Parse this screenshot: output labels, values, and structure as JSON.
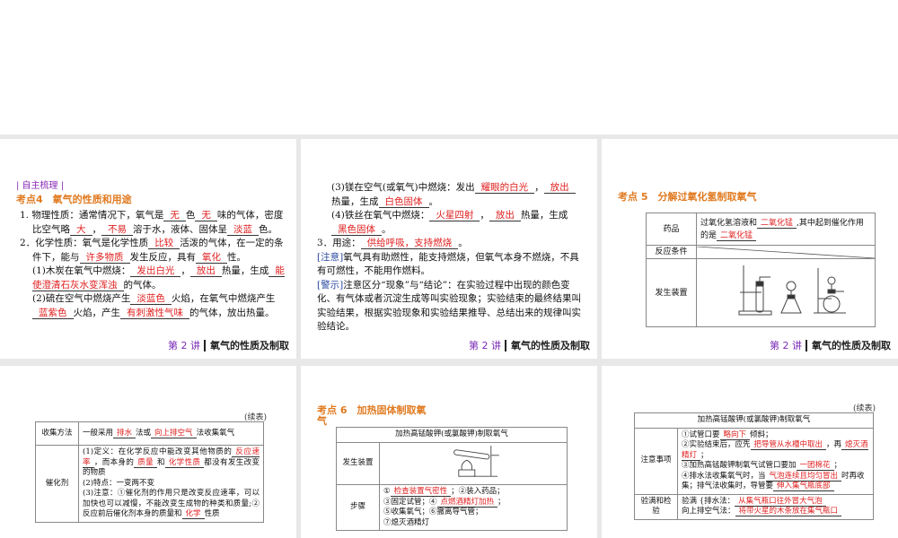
{
  "footer": {
    "num": "第 2 讲",
    "title": "氧气的性质及制取"
  },
  "s1": {
    "tag": "| 自主梳理 |",
    "heading": "考点4　氧气的性质和用途",
    "blocks": [
      [
        "1.  物理性质：通常情况下，氧气是",
        {
          "b": "无"
        },
        "色",
        {
          "b": "无"
        },
        "味的气体，密度比空气略",
        {
          "b": "大"
        },
        "，",
        {
          "b": "不易"
        },
        "溶于水，液体、固体呈",
        {
          "b": "淡蓝"
        },
        "色。"
      ],
      [
        "2．化学性质：氧气是化学性质",
        {
          "b": "比较"
        },
        "活泼的气体，在一定的条件下，能与",
        {
          "b": "许多物质"
        },
        "发生反应，具有",
        {
          "b": "氧化"
        },
        "性。"
      ],
      [
        "(1)木炭在氧气中燃烧：",
        {
          "b": "发出白光"
        },
        "，",
        {
          "b": "放出"
        },
        "热量，生成",
        {
          "b": "能使澄清石灰水变浑浊"
        },
        "的气体。"
      ],
      [
        "(2)硫在空气中燃烧产生",
        {
          "b": "淡蓝色"
        },
        "火焰，在氧气中燃烧产生",
        {
          "b": "蓝紫色"
        },
        "火焰，产生",
        {
          "b": "有刺激性气味"
        },
        "的气体，放出热量。"
      ]
    ]
  },
  "s2": {
    "blocks": [
      [
        "(3)镁在空气(或氧气)中燃烧：发出",
        {
          "b": "耀眼的白光"
        },
        "，",
        {
          "b": "放出"
        },
        "热量，生成",
        {
          "b": "白色固体"
        },
        "。"
      ],
      [
        "(4)铁丝在氧气中燃烧：",
        {
          "b": "火星四射"
        },
        "，",
        {
          "b": "放出"
        },
        "热量，生成",
        {
          "b": "黑色固体"
        },
        "。"
      ],
      [
        "3．用途：",
        {
          "b": "供给呼吸，支持燃烧"
        },
        "。"
      ],
      [
        {
          "n": "[注意]"
        },
        "氧气具有助燃性，能支持燃烧，但氧气本身不燃烧，不具有可燃性，不能用作燃料。"
      ],
      [
        {
          "n": "[警示]"
        },
        "注意区分“现象”与“结论”：在实验过程中出现的颜色变化、有气体或者沉淀生成等叫实验现象；实验结束的最终结果叫实验结果，根据实验现象和实验结果推导、总结出来的规律叫实验结论。"
      ]
    ]
  },
  "s3": {
    "heading": "考点 5　分解过氧化氢制取氧气",
    "rows": [
      {
        "h": "药品",
        "c": [
          "过氧化氢溶液和",
          {
            "b": "二氧化锰"
          },
          ",其中起到催化作用的是",
          {
            "b": "二氧化锰"
          }
        ]
      },
      {
        "h": "反应条件"
      },
      {
        "h": "发生装置"
      }
    ]
  },
  "s4": {
    "cont": "(续表)",
    "rows": [
      {
        "h": "收集方法",
        "c": [
          "一般采用",
          {
            "b": "排水"
          },
          "法或",
          {
            "b": "向上排空气"
          },
          "法收集氧气"
        ]
      },
      {
        "h": "催化剂",
        "c": [
          "(1)定义：在化学反应中能改变其他物质的",
          {
            "b": "反应速率"
          },
          "，而本身的",
          {
            "b": "质量"
          },
          "和",
          {
            "b": "化学性质"
          },
          "都没有发生改变的物质",
          {
            "br": 1
          },
          "(2)特点：一变两不变",
          {
            "br": 1
          },
          "(3)注意：①催化剂的作用只是改变反应速率，可以加快也可以减慢，不能改变生成物的种类和质量;②反应前后催化剂本身的质量和",
          {
            "b": "化学"
          },
          "性质"
        ]
      }
    ]
  },
  "s5": {
    "heading": "考点 6　加热固体制取氧气",
    "title": "加热高锰酸钾(或氯酸钾)制取氧气",
    "rows": [
      {
        "h": "发生装置"
      },
      {
        "h": "步骤",
        "c": [
          "①",
          {
            "b": "检查装置气密性"
          },
          "；②装入药品；",
          {
            "br": 1
          },
          "③固定试管；④",
          {
            "b": "点燃酒精灯加热"
          },
          "；",
          {
            "br": 1
          },
          "⑤收集氧气；⑥撤离导气管；",
          {
            "br": 1
          },
          "⑦熄灭酒精灯"
        ]
      }
    ]
  },
  "s6": {
    "cont": "(续表)",
    "title": "加热高锰酸钾(或氯酸钾)制取氧气",
    "rows": [
      {
        "h": "注意事项",
        "c": [
          "①试管口要",
          {
            "b": "略向下"
          },
          "倾斜；",
          {
            "br": 1
          },
          "②实验结束后，应先",
          {
            "b": "把导管从水槽中取出"
          },
          "，再",
          {
            "b": "熄灭酒精灯"
          },
          "；",
          {
            "br": 1
          },
          "③加热高锰酸钾制氧气试管口要加",
          {
            "b": "一团棉花"
          },
          "；",
          {
            "br": 1
          },
          "④排水法收集氧气时，当",
          {
            "b": "气泡连续且均匀冒出"
          },
          "时再收集；排气法收集时，导管要",
          {
            "b": "伸入集气瓶底部"
          }
        ]
      },
      {
        "h": "验满和检验",
        "c": [
          "验满 {排水法：",
          {
            "b": "从集气瓶口往外冒大气泡"
          },
          {
            "br": 1
          },
          "向上排空气法：",
          {
            "b": "将带火星的木条放在集气瓶口"
          }
        ]
      }
    ]
  }
}
